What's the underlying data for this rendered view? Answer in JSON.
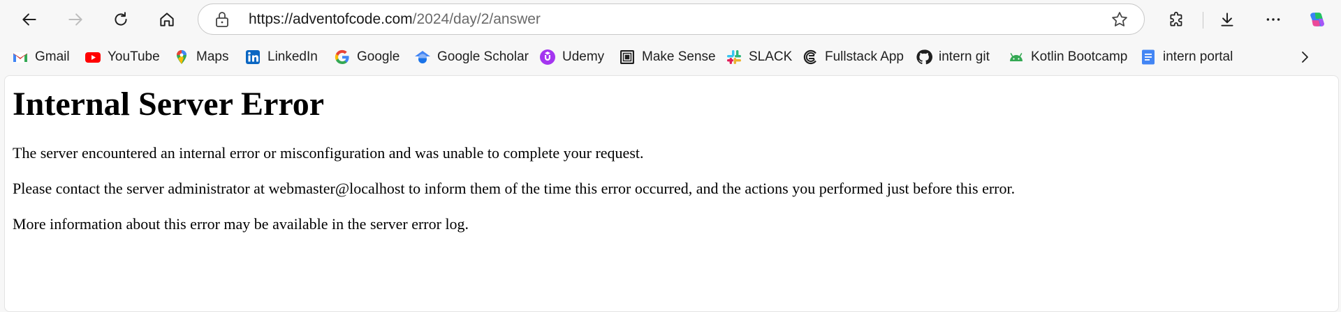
{
  "browser": {
    "url_host": "https://adventofcode.com",
    "url_path": "/2024/day/2/answer",
    "icons": {
      "back": "back-arrow-icon",
      "forward": "forward-arrow-icon",
      "refresh": "refresh-icon",
      "home": "home-icon",
      "lock": "lock-icon",
      "favorite": "star-icon",
      "extensions": "puzzle-icon",
      "downloads": "download-icon",
      "menu": "more-icon",
      "copilot": "copilot-icon"
    }
  },
  "bookmarks": [
    {
      "label": "Gmail",
      "icon": "gmail-icon"
    },
    {
      "label": "YouTube",
      "icon": "youtube-icon"
    },
    {
      "label": "Maps",
      "icon": "maps-icon"
    },
    {
      "label": "LinkedIn",
      "icon": "linkedin-icon"
    },
    {
      "label": "Google",
      "icon": "google-icon"
    },
    {
      "label": "Google Scholar",
      "icon": "scholar-icon"
    },
    {
      "label": "Udemy",
      "icon": "udemy-icon"
    },
    {
      "label": "Make Sense",
      "icon": "makesense-icon"
    },
    {
      "label": "SLACK",
      "icon": "slack-icon"
    },
    {
      "label": "Fullstack App",
      "icon": "fullstack-icon"
    },
    {
      "label": "intern git",
      "icon": "github-icon"
    },
    {
      "label": "Kotlin Bootcamp",
      "icon": "android-icon"
    },
    {
      "label": "intern portal",
      "icon": "docs-icon"
    }
  ],
  "page": {
    "heading": "Internal Server Error",
    "paragraphs": [
      "The server encountered an internal error or misconfiguration and was unable to complete your request.",
      "Please contact the server administrator at webmaster@localhost to inform them of the time this error occurred, and the actions you performed just before this error.",
      "More information about this error may be available in the server error log."
    ]
  },
  "colors": {
    "chrome_bg": "#f7f7f7",
    "page_bg": "#ffffff",
    "url_path": "#6a6a6a"
  }
}
